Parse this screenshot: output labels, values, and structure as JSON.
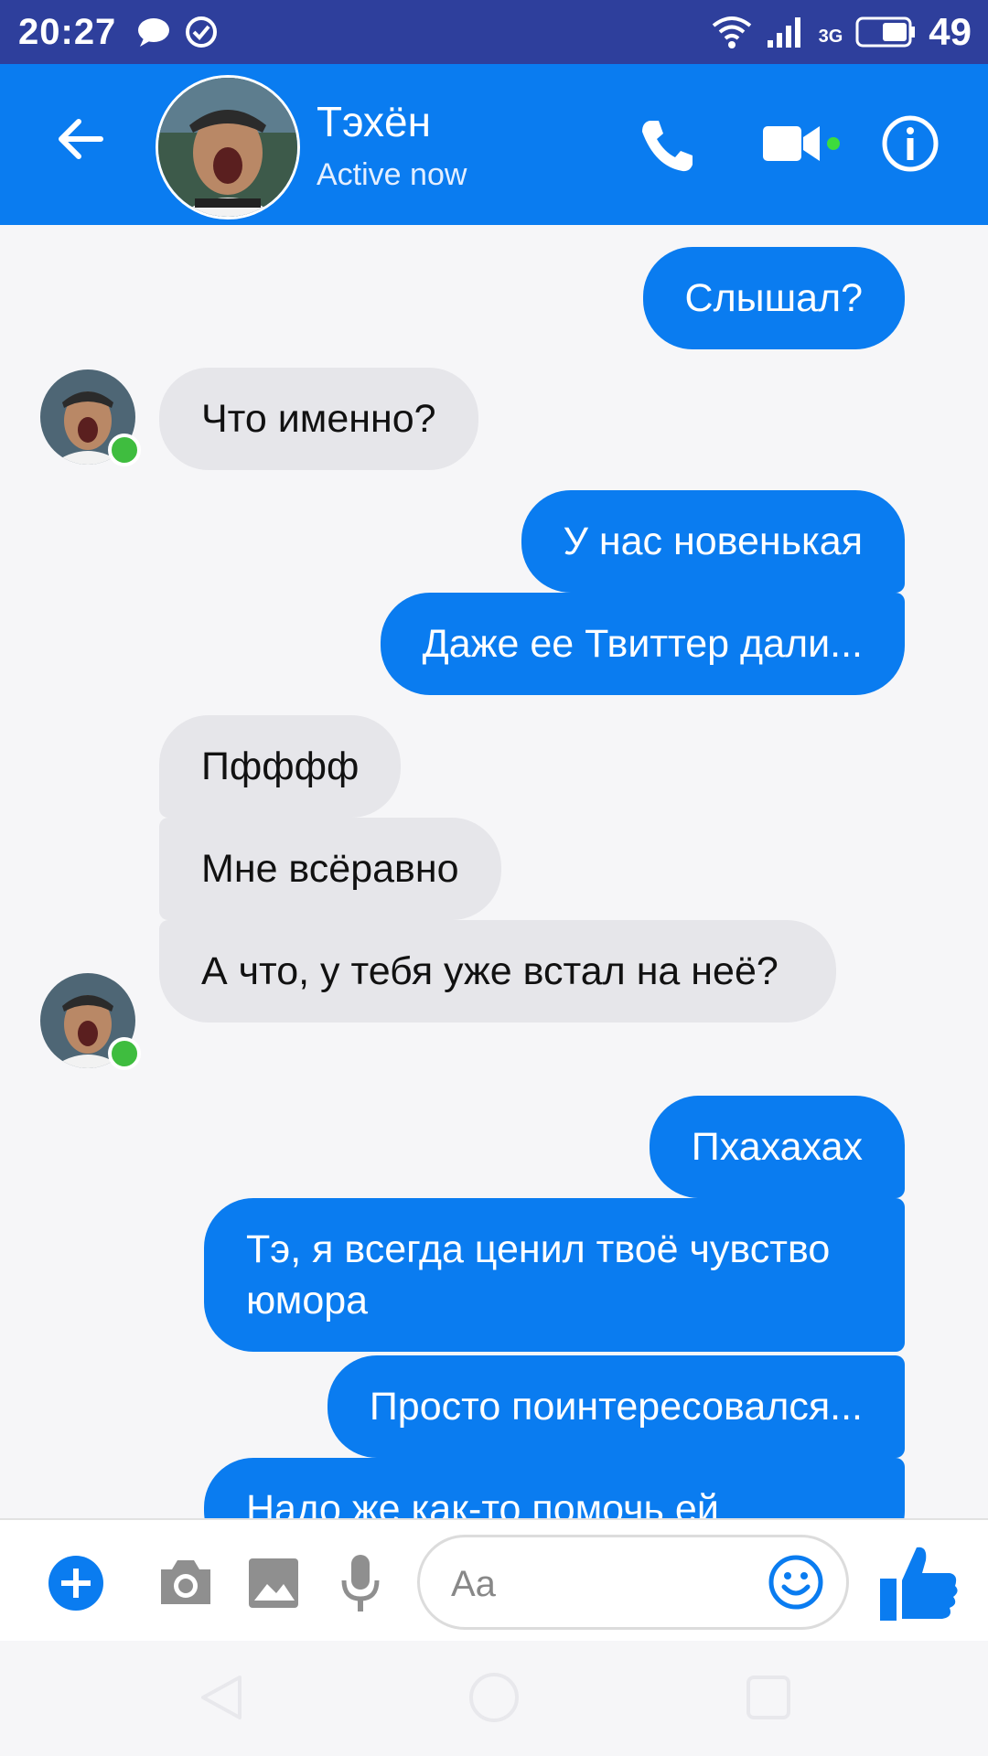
{
  "status_bar": {
    "time": "20:27",
    "network": "3G",
    "battery": "49",
    "icons": [
      "chat-bubble-icon",
      "check-circle-icon",
      "wifi-icon",
      "signal-icon",
      "battery-icon"
    ]
  },
  "header": {
    "name": "Тэхён",
    "status": "Active now",
    "accent_color": "#0a7cf0",
    "icons": [
      "back-arrow-icon",
      "phone-icon",
      "video-camera-icon",
      "info-icon"
    ]
  },
  "messages": [
    {
      "dir": "out",
      "text": "Слышал?"
    },
    {
      "dir": "in",
      "text": "Что именно?"
    },
    {
      "dir": "out",
      "text": "У нас новенькая"
    },
    {
      "dir": "out",
      "text": "Даже ее Твиттер дали..."
    },
    {
      "dir": "in",
      "text": "Пфффф"
    },
    {
      "dir": "in",
      "text": "Мне всёравно"
    },
    {
      "dir": "in",
      "text": "А что, у тебя уже встал на неё?"
    },
    {
      "dir": "out",
      "text": "Пхахахах"
    },
    {
      "dir": "out",
      "text": "Тэ, я всегда ценил твоё чувство юмора"
    },
    {
      "dir": "out",
      "text": "Просто поинтересовался..."
    },
    {
      "dir": "out",
      "text": "Надо же как-то помочь ей"
    }
  ],
  "composer": {
    "placeholder": "Aa",
    "icons": [
      "plus-icon",
      "camera-icon",
      "gallery-icon",
      "microphone-icon",
      "emoji-icon",
      "thumbs-up-icon"
    ]
  },
  "navbar": {
    "icons": [
      "nav-back-icon",
      "nav-home-icon",
      "nav-recent-icon"
    ]
  }
}
